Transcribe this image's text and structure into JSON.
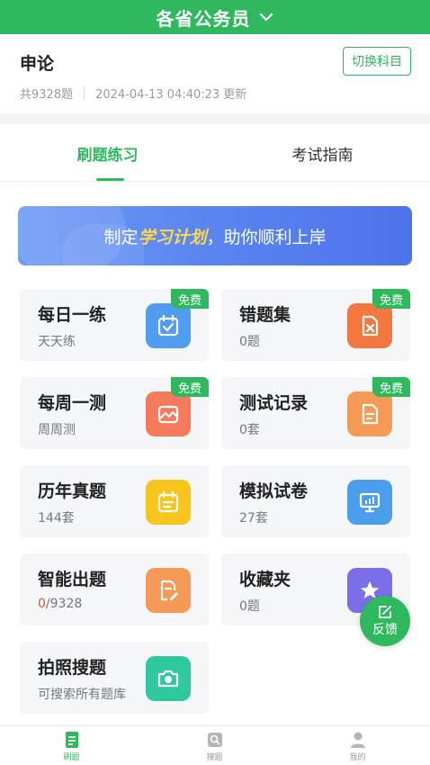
{
  "header": {
    "title": "各省公务员",
    "accent": "#2fb85d"
  },
  "subject": {
    "name": "申论",
    "count": "共9328题",
    "updated": "2024-04-13 04:40:23 更新",
    "switch_label": "切换科目"
  },
  "tabs": [
    {
      "label": "刷题练习",
      "active": true
    },
    {
      "label": "考试指南",
      "active": false
    }
  ],
  "banner": {
    "prefix": "制定",
    "highlight": "学习计划",
    "suffix": "，助你顺利上岸"
  },
  "cards": [
    {
      "title": "每日一练",
      "sub": "天天练",
      "icon": "calendar-check-icon",
      "color": "#4f9cf0",
      "free": "免费"
    },
    {
      "title": "错题集",
      "sub": "0题",
      "icon": "wrong-doc-icon",
      "color": "#f2783f",
      "free": "免费"
    },
    {
      "title": "每周一测",
      "sub": "周周测",
      "icon": "image-chart-icon",
      "color": "#f47a5b",
      "free": "免费"
    },
    {
      "title": "测试记录",
      "sub": "0套",
      "icon": "document-icon",
      "color": "#f59a56",
      "free": "免费"
    },
    {
      "title": "历年真题",
      "sub": "144套",
      "icon": "calendar-list-icon",
      "color": "#f8c51d",
      "free": ""
    },
    {
      "title": "模拟试卷",
      "sub": "27套",
      "icon": "presentation-icon",
      "color": "#4b9ded",
      "free": ""
    },
    {
      "title": "智能出题",
      "sub_done": "0",
      "sub_total": "/9328",
      "icon": "edit-doc-icon",
      "color": "#f59a56",
      "free": ""
    },
    {
      "title": "收藏夹",
      "sub": "0题",
      "icon": "star-icon",
      "color": "#7c6ee8",
      "free": ""
    },
    {
      "title": "拍照搜题",
      "sub": "可搜索所有题库",
      "icon": "camera-icon",
      "color": "#2ec99c",
      "free": ""
    }
  ],
  "feedback": {
    "label": "反馈"
  },
  "bottom_nav": [
    {
      "label": "刷题",
      "icon": "doc-icon",
      "active": true
    },
    {
      "label": "搜题",
      "icon": "search-icon",
      "active": false
    },
    {
      "label": "我的",
      "icon": "user-icon",
      "active": false
    }
  ]
}
